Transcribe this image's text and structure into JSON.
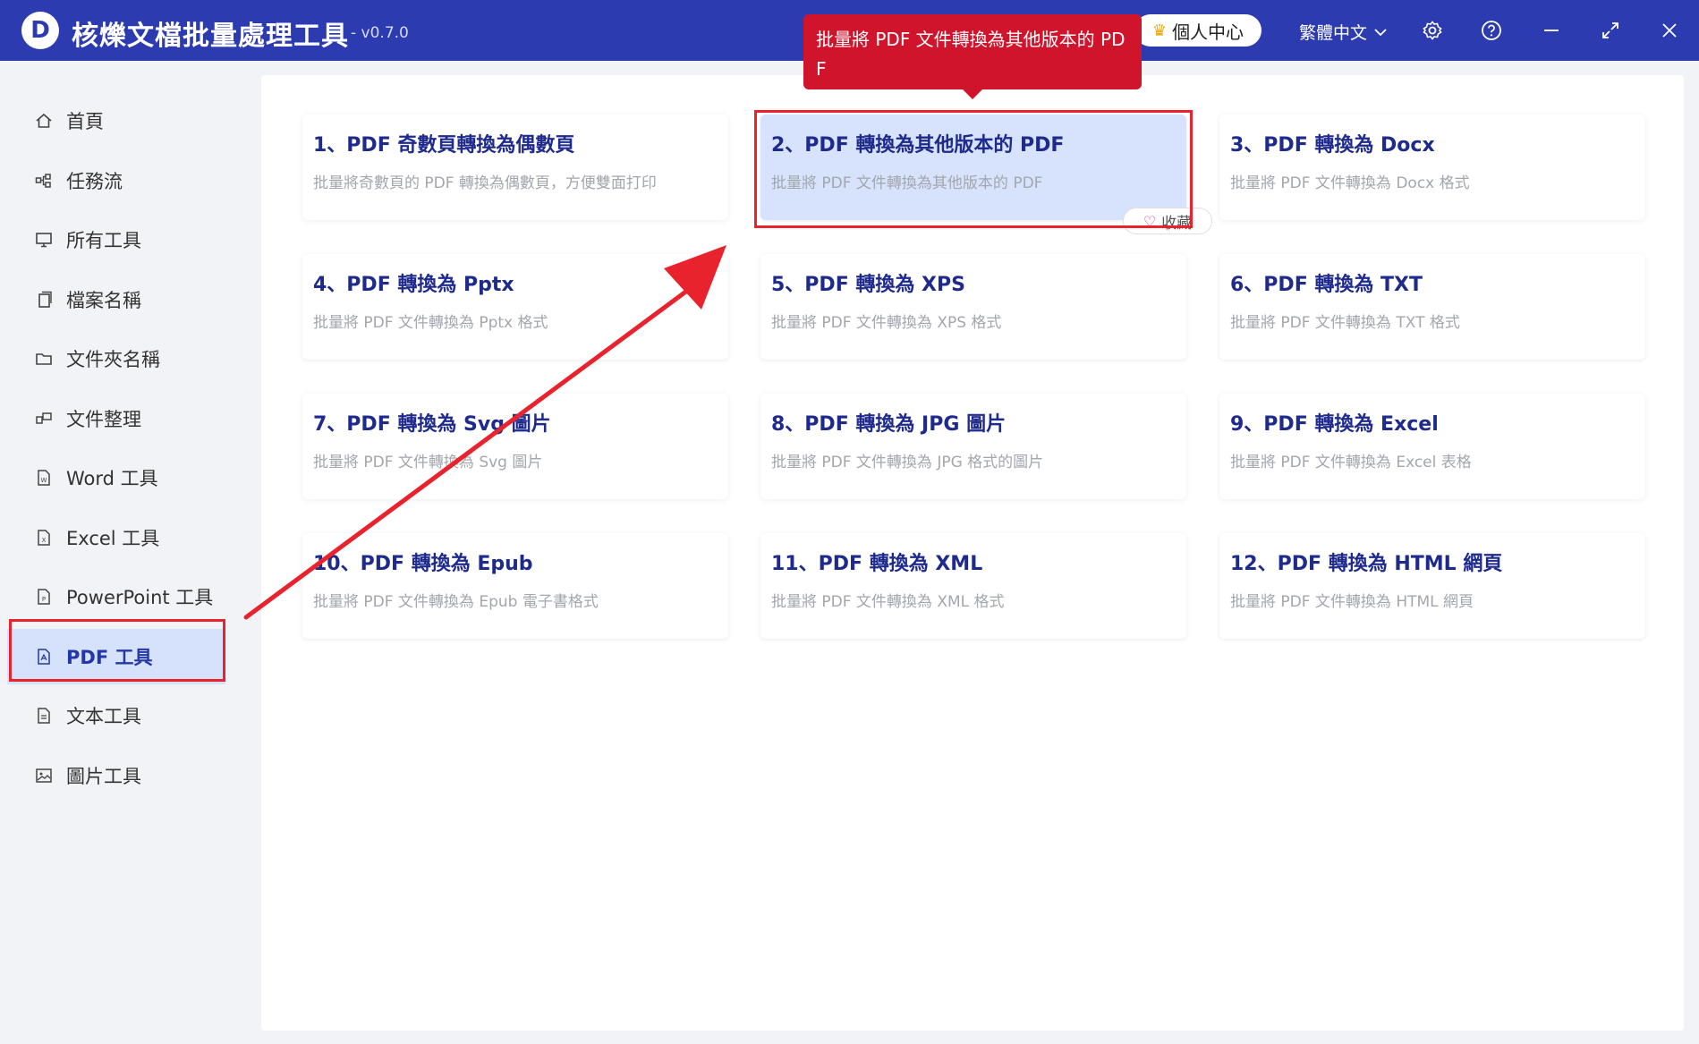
{
  "app": {
    "logo_letter": "D",
    "title": "核爍文檔批量處理工具",
    "version": "- v0.7.0"
  },
  "header": {
    "user_center": "個人中心",
    "language": "繁體中文",
    "icons": [
      "settings-icon",
      "help-icon",
      "minimize-icon",
      "maximize-icon",
      "close-icon"
    ]
  },
  "tooltip": {
    "text": "批量將 PDF 文件轉換為其他版本的 PDF"
  },
  "sidebar": {
    "items": [
      {
        "label": "首頁",
        "icon": "home-icon"
      },
      {
        "label": "任務流",
        "icon": "workflow-icon"
      },
      {
        "label": "所有工具",
        "icon": "monitor-icon"
      },
      {
        "label": "檔案名稱",
        "icon": "file-copy-icon"
      },
      {
        "label": "文件夾名稱",
        "icon": "folder-icon"
      },
      {
        "label": "文件整理",
        "icon": "organize-icon"
      },
      {
        "label": "Word 工具",
        "icon": "word-file-icon"
      },
      {
        "label": "Excel 工具",
        "icon": "excel-file-icon"
      },
      {
        "label": "PowerPoint 工具",
        "icon": "powerpoint-file-icon"
      },
      {
        "label": "PDF 工具",
        "icon": "pdf-file-icon",
        "active": true
      },
      {
        "label": "文本工具",
        "icon": "text-file-icon"
      },
      {
        "label": "圖片工具",
        "icon": "image-icon"
      }
    ]
  },
  "cards": [
    {
      "title": "1、PDF 奇數頁轉換為偶數頁",
      "desc": "批量將奇數頁的 PDF 轉換為偶數頁，方便雙面打印"
    },
    {
      "title": "2、PDF 轉換為其他版本的 PDF",
      "desc": "批量將 PDF 文件轉換為其他版本的 PDF",
      "selected": true
    },
    {
      "title": "3、PDF 轉換為 Docx",
      "desc": "批量將 PDF 文件轉換為 Docx 格式"
    },
    {
      "title": "4、PDF 轉換為 Pptx",
      "desc": "批量將 PDF 文件轉換為 Pptx 格式"
    },
    {
      "title": "5、PDF 轉換為 XPS",
      "desc": "批量將 PDF 文件轉換為 XPS 格式"
    },
    {
      "title": "6、PDF 轉換為 TXT",
      "desc": "批量將 PDF 文件轉換為 TXT 格式"
    },
    {
      "title": "7、PDF 轉換為 Svg 圖片",
      "desc": "批量將 PDF 文件轉換為 Svg 圖片"
    },
    {
      "title": "8、PDF 轉換為 JPG 圖片",
      "desc": "批量將 PDF 文件轉換為 JPG 格式的圖片"
    },
    {
      "title": "9、PDF 轉換為 Excel",
      "desc": "批量將 PDF 文件轉換為 Excel 表格"
    },
    {
      "title": "10、PDF 轉換為 Epub",
      "desc": "批量將 PDF 文件轉換為 Epub 電子書格式"
    },
    {
      "title": "11、PDF 轉換為 XML",
      "desc": "批量將 PDF 文件轉換為 XML 格式"
    },
    {
      "title": "12、PDF 轉換為 HTML 網頁",
      "desc": "批量將 PDF 文件轉換為 HTML 網頁"
    }
  ],
  "favorite_label": "收藏",
  "colors": {
    "titlebar": "#2d3bb0",
    "accent_title": "#1e2a8c",
    "highlight": "#e8232e",
    "selected_bg": "#d7e3fc",
    "tooltip_bg": "#d0142b"
  }
}
